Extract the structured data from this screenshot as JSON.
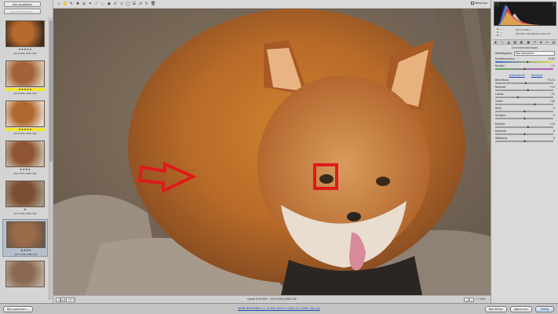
{
  "filmstrip": {
    "top_button_label": "Alle auswählen",
    "second_button_label": "Synchronisieren...",
    "thumbnails": [
      {
        "stars": "★★★★★",
        "name": "20171006_0281.CR2",
        "highlight": false,
        "selected": false
      },
      {
        "stars": "★★★★★",
        "name": "20171006_0282.CR2",
        "highlight": true,
        "selected": false
      },
      {
        "stars": "★★★★★",
        "name": "20171006_0283.CR2",
        "highlight": true,
        "selected": false
      },
      {
        "stars": "★★★★",
        "name": "20171006_0284.CR2",
        "highlight": false,
        "selected": false
      },
      {
        "stars": "★",
        "name": "20171006_0285.CR2",
        "highlight": false,
        "selected": false
      },
      {
        "stars": "★★★★",
        "name": "20171006_0286.CR2",
        "highlight": false,
        "selected": true
      },
      {
        "stars": "",
        "name": "",
        "highlight": false,
        "selected": false
      }
    ]
  },
  "toolbar": {
    "tools": [
      "zoom-icon",
      "hand-icon",
      "white-balance-icon",
      "color-sampler-icon",
      "target-adjust-icon",
      "crop-icon",
      "straighten-icon",
      "spot-removal-icon",
      "red-eye-icon",
      "adjustment-brush-icon",
      "graduated-filter-icon",
      "radial-filter-icon",
      "preferences-icon",
      "rotate-left-icon",
      "rotate-right-icon",
      "trash-icon"
    ],
    "preview_label": "Vorschau"
  },
  "status": {
    "zoom": "100%",
    "camera_info": "Canon EOS 5D II - 20171006_0286.CR2",
    "counter": "7 / 1001"
  },
  "histogram": {
    "readout_left": [
      "R: ---",
      "G: ---",
      "B: ---"
    ],
    "readout_right": [
      "f/5,6   1/500 s",
      "ISO 800   100-400 bei 400 mm"
    ]
  },
  "right_panel": {
    "tabs": [
      "basic-icon",
      "tone-curve-icon",
      "detail-icon",
      "hsl-icon",
      "split-toning-icon",
      "lens-icon",
      "effects-icon",
      "camera-calibration-icon",
      "presets-icon",
      "snapshots-icon"
    ],
    "title": "Grundeinstellungen",
    "wb_label": "Weißabgleich:",
    "wb_value": "Wie Aufnahme",
    "auto_label": "Automatisch",
    "default_label": "Standard",
    "sliders_top": [
      {
        "label": "Farbtemperatur",
        "value": "5150",
        "pos": 0.55
      },
      {
        "label": "Farbton",
        "value": "+1",
        "pos": 0.5
      }
    ],
    "sliders_bottom": [
      {
        "label": "Belichtung",
        "value": "+0,15",
        "pos": 0.52
      },
      {
        "label": "Kontrast",
        "value": "+13",
        "pos": 0.56
      },
      {
        "label": "Lichter",
        "value": "-31",
        "pos": 0.38
      },
      {
        "label": "Tiefen",
        "value": "+40",
        "pos": 0.68
      },
      {
        "label": "Weiß",
        "value": "0",
        "pos": 0.5
      },
      {
        "label": "Schwarz",
        "value": "0",
        "pos": 0.5
      }
    ],
    "sliders_presence": [
      {
        "label": "Klarheit",
        "value": "+14",
        "pos": 0.56
      },
      {
        "label": "Dynamik",
        "value": "0",
        "pos": 0.5
      },
      {
        "label": "Sättigung",
        "value": "0",
        "pos": 0.5
      }
    ]
  },
  "footer": {
    "save_label": "Bild speichern...",
    "workflow_link": "sRGB IEC61966-2.1; 16 Bit; 5616 x 3744 (21,0 MP); 240 ppi",
    "open_label": "Bild öffnen",
    "cancel_label": "Abbrechen",
    "done_label": "Fertig"
  }
}
